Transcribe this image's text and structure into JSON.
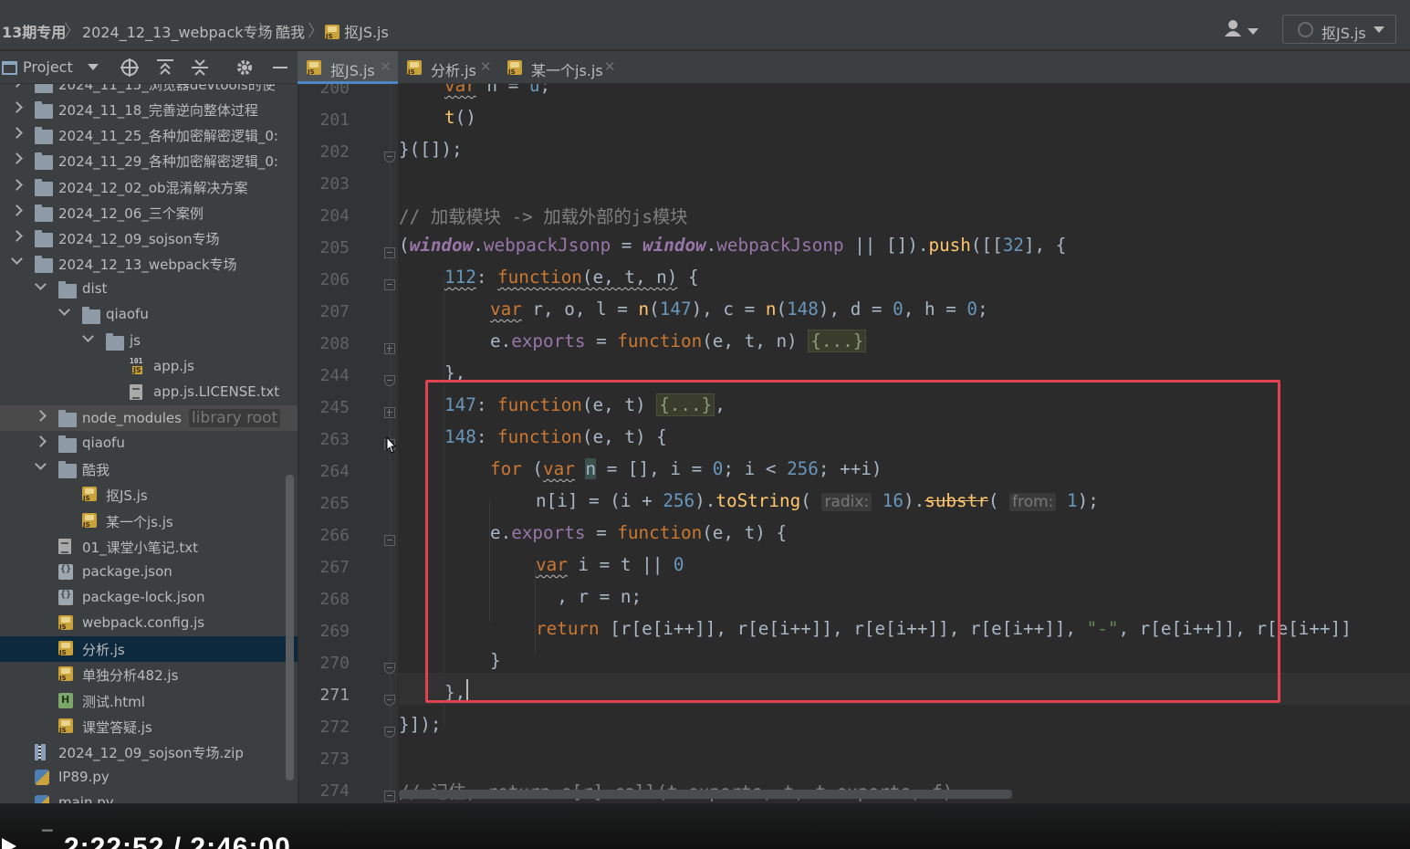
{
  "navbar": {
    "breadcrumbs": [
      "13期专用",
      "2024_12_13_webpack专场",
      "酷我",
      "抠JS.js"
    ],
    "run_config": "抠JS.js"
  },
  "project_panel": {
    "title": "Project",
    "tree": [
      {
        "label": "2024_11_15_浏览器devtools的使",
        "type": "folder",
        "depth": 1,
        "state": "closed"
      },
      {
        "label": "2024_11_18_完善逆向整体过程",
        "type": "folder",
        "depth": 1,
        "state": "closed"
      },
      {
        "label": "2024_11_25_各种加密解密逻辑_0:",
        "type": "folder",
        "depth": 1,
        "state": "closed"
      },
      {
        "label": "2024_11_29_各种加密解密逻辑_0:",
        "type": "folder",
        "depth": 1,
        "state": "closed"
      },
      {
        "label": "2024_12_02_ob混淆解决方案",
        "type": "folder",
        "depth": 1,
        "state": "closed"
      },
      {
        "label": "2024_12_06_三个案例",
        "type": "folder",
        "depth": 1,
        "state": "closed"
      },
      {
        "label": "2024_12_09_sojson专场",
        "type": "folder",
        "depth": 1,
        "state": "closed"
      },
      {
        "label": "2024_12_13_webpack专场",
        "type": "folder",
        "depth": 1,
        "state": "open"
      },
      {
        "label": "dist",
        "type": "folder",
        "depth": 2,
        "state": "open"
      },
      {
        "label": "qiaofu",
        "type": "folder",
        "depth": 3,
        "state": "open"
      },
      {
        "label": "js",
        "type": "folder",
        "depth": 4,
        "state": "open"
      },
      {
        "label": "app.js",
        "type": "binjs",
        "depth": 5
      },
      {
        "label": "app.js.LICENSE.txt",
        "type": "txt",
        "depth": 5
      },
      {
        "label": "node_modules",
        "hint": "library root",
        "type": "folder",
        "depth": 2,
        "state": "closed",
        "highlight": true
      },
      {
        "label": "qiaofu",
        "type": "folder",
        "depth": 2,
        "state": "closed"
      },
      {
        "label": "酷我",
        "type": "folder",
        "depth": 2,
        "state": "open"
      },
      {
        "label": "抠JS.js",
        "type": "js",
        "depth": 3
      },
      {
        "label": "某一个js.js",
        "type": "js",
        "depth": 3
      },
      {
        "label": "01_课堂小笔记.txt",
        "type": "txt",
        "depth": 2
      },
      {
        "label": "package.json",
        "type": "json",
        "depth": 2
      },
      {
        "label": "package-lock.json",
        "type": "json",
        "depth": 2
      },
      {
        "label": "webpack.config.js",
        "type": "js",
        "depth": 2
      },
      {
        "label": "分析.js",
        "type": "js",
        "depth": 2,
        "selected": true
      },
      {
        "label": "单独分析482.js",
        "type": "js",
        "depth": 2
      },
      {
        "label": "测试.html",
        "type": "html",
        "depth": 2
      },
      {
        "label": "课堂答疑.js",
        "type": "js",
        "depth": 2
      },
      {
        "label": "2024_12_09_sojson专场.zip",
        "type": "zip",
        "depth": 1
      },
      {
        "label": "IP89.py",
        "type": "py",
        "depth": 1
      },
      {
        "label": "main.py",
        "type": "py",
        "depth": 1
      }
    ]
  },
  "tabs": [
    {
      "label": "抠JS.js",
      "active": true
    },
    {
      "label": "分析.js",
      "active": false
    },
    {
      "label": "某一个js.js",
      "active": false
    }
  ],
  "editor": {
    "line_numbers": [
      "200",
      "201",
      "202",
      "203",
      "204",
      "205",
      "206",
      "207",
      "208",
      "244",
      "245",
      "263",
      "264",
      "265",
      "266",
      "267",
      "268",
      "269",
      "270",
      "271",
      "272",
      "273",
      "274"
    ],
    "current_line": "271"
  },
  "video": {
    "time": "2:22:52 / 2:46:00"
  }
}
